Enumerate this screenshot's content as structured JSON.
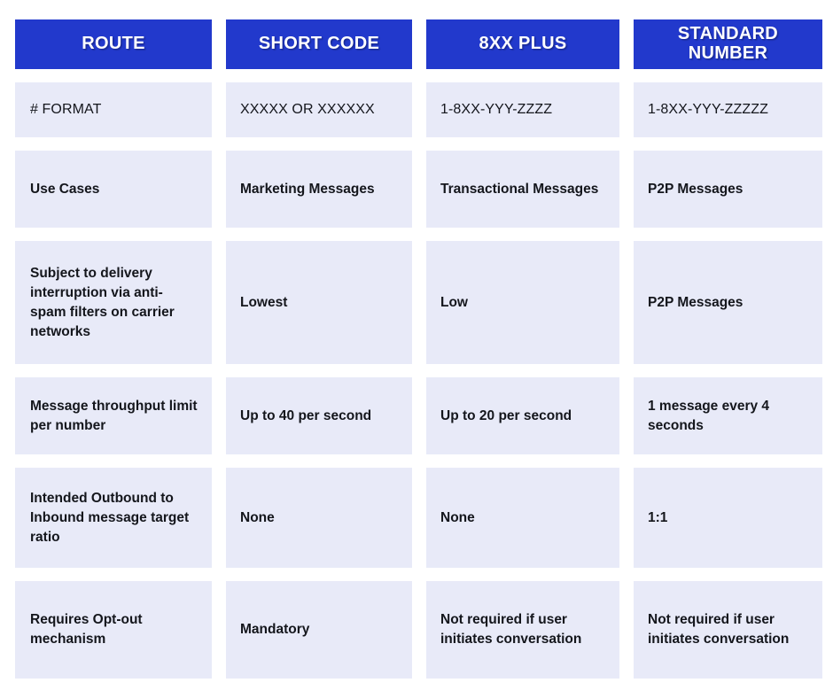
{
  "table": {
    "columns": [
      {
        "id": "route",
        "header": "ROUTE"
      },
      {
        "id": "short_code",
        "header": "SHORT CODE"
      },
      {
        "id": "eight_xx_plus",
        "header": "8XX PLUS"
      },
      {
        "id": "standard_number",
        "header": "STANDARD NUMBER"
      }
    ],
    "rows": [
      {
        "id": "number-format",
        "label": "# FORMAT",
        "short_code": "XXXXX OR XXXXXX",
        "eight_xx_plus": "1-8XX-YYY-ZZZZ",
        "standard_number": "1-8XX-YYY-ZZZZZ"
      },
      {
        "id": "use-cases",
        "label": "Use Cases",
        "short_code": "Marketing Messages",
        "eight_xx_plus": "Transactional Messages",
        "standard_number": "P2P Messages"
      },
      {
        "id": "delivery-interruption",
        "label": "Subject to delivery interruption via anti-spam filters on carrier networks",
        "short_code": "Lowest",
        "eight_xx_plus": "Low",
        "standard_number": "P2P Messages"
      },
      {
        "id": "throughput-limit",
        "label": "Message throughput limit per number",
        "short_code": "Up to 40 per second",
        "eight_xx_plus": "Up to 20 per second",
        "standard_number": "1 message every 4 seconds"
      },
      {
        "id": "outbound-inbound-ratio",
        "label": "Intended Outbound to Inbound message target ratio",
        "short_code": "None",
        "eight_xx_plus": "None",
        "standard_number": "1:1"
      },
      {
        "id": "opt-out-mechanism",
        "label": "Requires Opt-out mechanism",
        "short_code": "Mandatory",
        "eight_xx_plus": "Not required if user initiates conversation",
        "standard_number": "Not required if user initiates conversation"
      }
    ]
  },
  "colors": {
    "header_background": "#2239CC",
    "header_text": "#FFFFFF",
    "cell_background": "#E8EAF8",
    "cell_text": "#14161C",
    "page_background": "#FFFFFF"
  }
}
